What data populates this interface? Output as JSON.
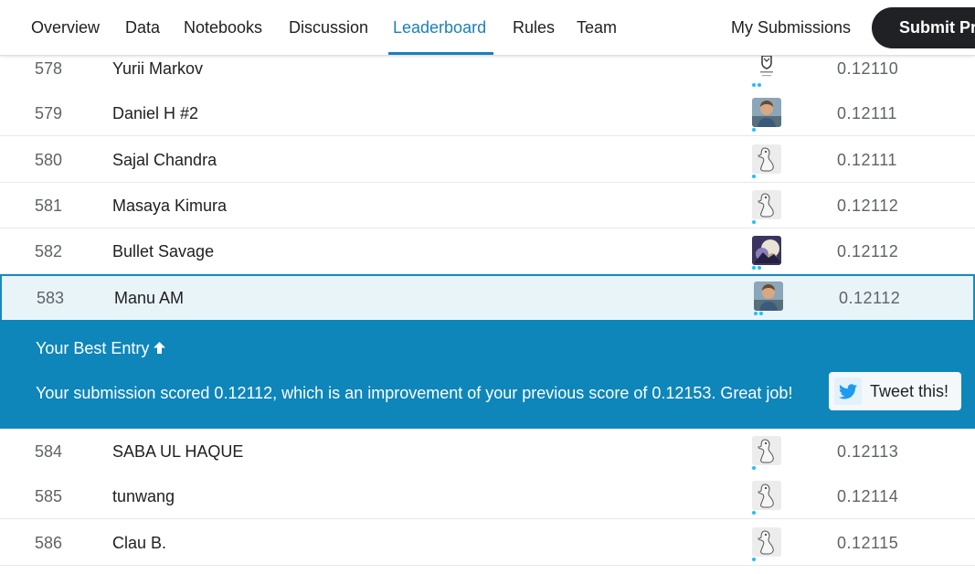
{
  "nav": {
    "tabs": [
      {
        "label": "Overview"
      },
      {
        "label": "Data"
      },
      {
        "label": "Notebooks"
      },
      {
        "label": "Discussion"
      },
      {
        "label": "Leaderboard"
      },
      {
        "label": "Rules"
      },
      {
        "label": "Team"
      }
    ],
    "active_tab": "Leaderboard",
    "my_submissions": "My Submissions",
    "submit_button": "Submit Pr"
  },
  "rows_before": [
    {
      "rank": "578",
      "name": "Yurii Markov",
      "score": "0.12110",
      "avatar": "logo-avatar",
      "dots": 2
    },
    {
      "rank": "579",
      "name": "Daniel H #2",
      "score": "0.12111",
      "avatar": "photo-avatar",
      "dots": 1
    },
    {
      "rank": "580",
      "name": "Sajal Chandra",
      "score": "0.12111",
      "avatar": "goose-avatar",
      "dots": 1
    },
    {
      "rank": "581",
      "name": "Masaya Kimura",
      "score": "0.12112",
      "avatar": "goose-avatar",
      "dots": 1
    },
    {
      "rank": "582",
      "name": "Bullet Savage",
      "score": "0.12112",
      "avatar": "artwork-avatar",
      "dots": 2
    },
    {
      "rank": "583",
      "name": "Manu AM",
      "score": "0.12112",
      "avatar": "photo-avatar",
      "dots": 2
    }
  ],
  "banner": {
    "title": "Your Best Entry",
    "message": "Your submission scored 0.12112, which is an improvement of your previous score of 0.12153. Great job!",
    "tweet_label": "Tweet this!"
  },
  "rows_after": [
    {
      "rank": "584",
      "name": "SABA UL HAQUE",
      "score": "0.12113",
      "avatar": "goose-avatar",
      "dots": 1
    },
    {
      "rank": "585",
      "name": "tunwang",
      "score": "0.12114",
      "avatar": "goose-avatar",
      "dots": 1
    },
    {
      "rank": "586",
      "name": "Clau B.",
      "score": "0.12115",
      "avatar": "goose-avatar",
      "dots": 1
    }
  ],
  "colors": {
    "accent": "#1a7fba",
    "banner": "#0e86ba",
    "highlight_row": "#e9f4f9",
    "tier_dot": "#20beff"
  }
}
